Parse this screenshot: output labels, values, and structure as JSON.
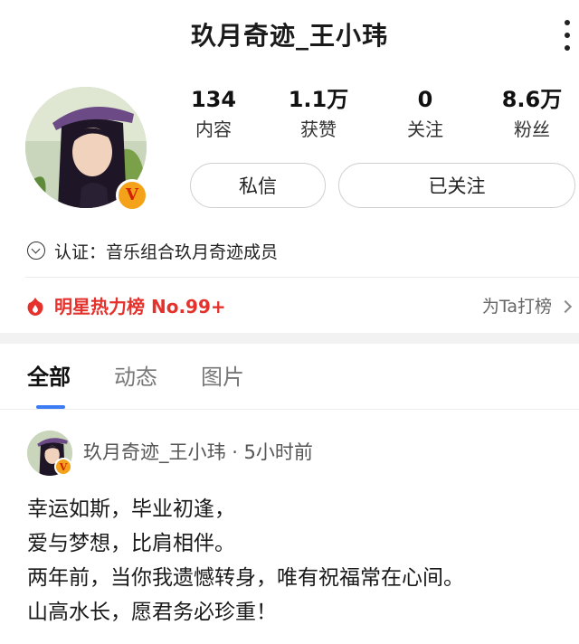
{
  "header": {
    "title": "玖月奇迹_王小玮"
  },
  "stats": [
    {
      "value": "134",
      "label": "内容"
    },
    {
      "value": "1.1万",
      "label": "获赞"
    },
    {
      "value": "0",
      "label": "关注"
    },
    {
      "value": "8.6万",
      "label": "粉丝"
    }
  ],
  "actions": {
    "message": "私信",
    "follow": "已关注"
  },
  "profile": {
    "badge": "V",
    "verification": "认证：音乐组合玖月奇迹成员"
  },
  "hot_rank": {
    "label": "明星热力榜 No.99+",
    "vote": "为Ta打榜"
  },
  "tabs": [
    {
      "label": "全部"
    },
    {
      "label": "动态"
    },
    {
      "label": "图片"
    }
  ],
  "post": {
    "author": "玖月奇迹_王小玮",
    "time": "5小时前",
    "lines": [
      "幸运如斯，毕业初逢，",
      "爱与梦想，比肩相伴。",
      "两年前，当你我遗憾转身，唯有祝福常在心间。",
      "山高水长，愿君务必珍重！"
    ]
  },
  "colors": {
    "accent_red": "#e5322d",
    "tab_indicator": "#3b7cf5",
    "badge_gold": "#f3a21a"
  }
}
